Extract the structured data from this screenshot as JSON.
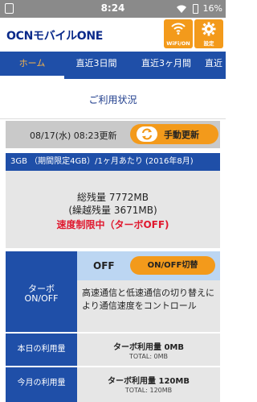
{
  "status_bar": {
    "time": "8:24",
    "battery": "16%",
    "icons": [
      "sim-icon",
      "wifi-icon",
      "battery-icon"
    ]
  },
  "header": {
    "logo": "OCNモバイルONE",
    "wifi_button_label": "WiFi/ON",
    "settings_button_label": "設定",
    "accent_color": "#f39a1b",
    "icons": [
      "wifi-icon",
      "gear-icon"
    ]
  },
  "tabs": [
    {
      "label": "ホーム",
      "active": true
    },
    {
      "label": "直近3日間",
      "active": false
    },
    {
      "label": "直近3ヶ月間",
      "active": false
    },
    {
      "label": "直近",
      "active": false
    }
  ],
  "section_title": "ご利用状況",
  "update": {
    "time": "08/17(水) 08:23更新",
    "button_label": "手動更新",
    "icon": "refresh-icon"
  },
  "plan": "3GB （期間限定4GB）/1ヶ月あたり (2016年8月)",
  "remaining": {
    "total": "総残量 7772MB",
    "carryover": "(繰越残量 3671MB)",
    "speed_limit": "速度制限中（ターボOFF)"
  },
  "turbo": {
    "label_line1": "ターボ",
    "label_line2": "ON/OFF",
    "state": "OFF",
    "toggle_label": "ON/OFF切替",
    "description": "高速通信と低速通信の切り替えにより通信速度をコントロール"
  },
  "usage": [
    {
      "label": "本日の利用量",
      "turbo": "ターボ利用量 0MB",
      "total": "TOTAL: 0MB"
    },
    {
      "label": "今月の利用量",
      "turbo": "ターボ利用量 120MB",
      "total": "TOTAL: 120MB"
    }
  ],
  "colors": {
    "primary_blue": "#1f4fa8",
    "light_blue": "#bcd6f2",
    "orange": "#f39a1b",
    "gray": "#e6e6e6",
    "alert_red": "#e0182e"
  }
}
